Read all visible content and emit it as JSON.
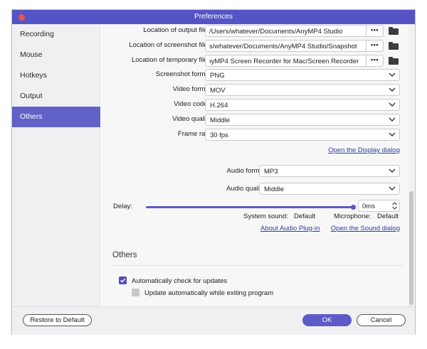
{
  "window": {
    "title": "Preferences"
  },
  "sidebar": {
    "items": [
      {
        "label": "Recording"
      },
      {
        "label": "Mouse"
      },
      {
        "label": "Hotkeys"
      },
      {
        "label": "Output"
      },
      {
        "label": "Others"
      }
    ],
    "active": "Others"
  },
  "output": {
    "output_files_label": "Location of output files:",
    "output_files_value": "/Users/whatever/Documents/AnyMP4 Studio",
    "screenshot_files_label": "Location of screenshot files:",
    "screenshot_files_value": "s/whatever/Documents/AnyMP4 Studio/Snapshot",
    "temp_files_label": "Location of temporary files:",
    "temp_files_value": "ıyMP4 Screen Recorder for Mac/Screen Recorder",
    "browse_label": "•••",
    "screenshot_format_label": "Screenshot format:",
    "screenshot_format_value": "PNG",
    "video_format_label": "Video format:",
    "video_format_value": "MOV",
    "video_codec_label": "Video codec:",
    "video_codec_value": "H.264",
    "video_quality_label": "Video quality:",
    "video_quality_value": "Middle",
    "frame_rate_label": "Frame rate:",
    "frame_rate_value": "30 fps",
    "display_dialog_link": "Open the Display dialog",
    "audio_format_label": "Audio format:",
    "audio_format_value": "MP3",
    "audio_quality_label": "Audio quality:",
    "audio_quality_value": "Middle",
    "delay_label": "Delay:",
    "delay_value": "0ms",
    "delay_slider_fraction": 1.0,
    "system_sound_label": "System sound:",
    "system_sound_value": "Default",
    "microphone_label": "Microphone:",
    "microphone_value": "Default",
    "audio_plugin_link": "About Audio Plug-in",
    "sound_dialog_link": "Open the Sound dialog"
  },
  "others": {
    "section_title": "Others",
    "auto_check_label": "Automatically check for updates",
    "auto_check_checked": true,
    "auto_update_label": "Update automatically while exiting program",
    "auto_update_checked": false
  },
  "footer": {
    "restore_label": "Restore to Default",
    "ok_label": "OK",
    "cancel_label": "Cancel"
  },
  "colors": {
    "accent": "#5d5bc8",
    "titlebar": "#5554c4",
    "close": "#e9564e",
    "link": "#2f3d9a"
  }
}
